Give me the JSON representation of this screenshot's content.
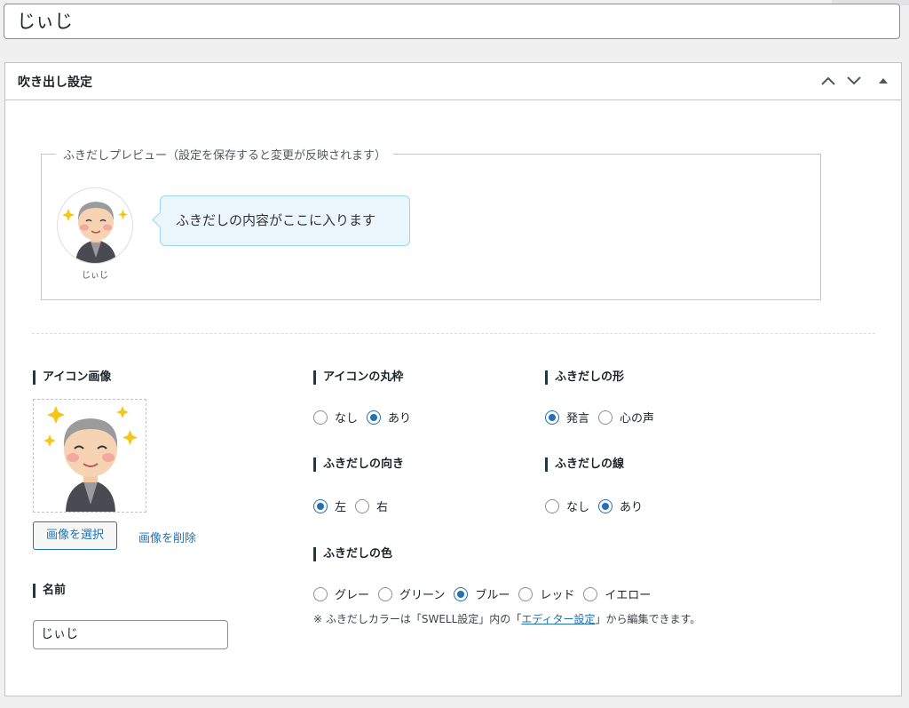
{
  "post_title": "じぃじ",
  "metabox": {
    "title": "吹き出し設定"
  },
  "preview": {
    "legend": "ふきだしプレビュー（設定を保存すると変更が反映されます）",
    "bubble_text": "ふきだしの内容がここに入ります",
    "name": "じぃじ"
  },
  "icon_image": {
    "label": "アイコン画像",
    "select_button": "画像を選択",
    "delete_link": "画像を削除"
  },
  "name_field": {
    "label": "名前",
    "value": "じぃじ"
  },
  "icon_border": {
    "label": "アイコンの丸枠",
    "options": [
      "なし",
      "あり"
    ],
    "selected": "あり"
  },
  "bubble_shape": {
    "label": "ふきだしの形",
    "options": [
      "発言",
      "心の声"
    ],
    "selected": "発言"
  },
  "bubble_direction": {
    "label": "ふきだしの向き",
    "options": [
      "左",
      "右"
    ],
    "selected": "左"
  },
  "bubble_line": {
    "label": "ふきだしの線",
    "options": [
      "なし",
      "あり"
    ],
    "selected": "あり"
  },
  "bubble_color": {
    "label": "ふきだしの色",
    "options": [
      "グレー",
      "グリーン",
      "ブルー",
      "レッド",
      "イエロー"
    ],
    "selected": "ブルー",
    "note_prefix": "※ ふきだしカラーは「SWELL設定」内の「",
    "note_link": "エディター設定",
    "note_suffix": "」から編集できます。"
  },
  "colors": {
    "accent": "#2271b1",
    "bubble_bg": "#eaf6fc",
    "bubble_border": "#9ed6ee"
  }
}
